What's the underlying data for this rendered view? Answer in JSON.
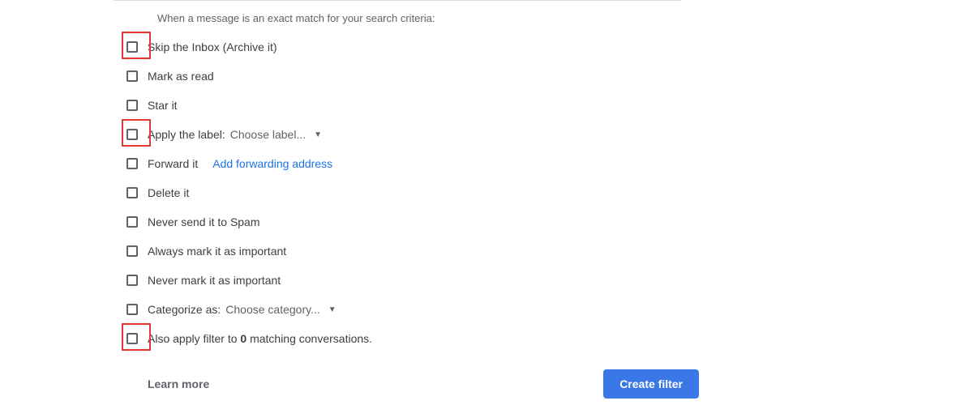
{
  "header": "When a message is an exact match for your search criteria:",
  "options": {
    "skip_inbox": "Skip the Inbox (Archive it)",
    "mark_read": "Mark as read",
    "star": "Star it",
    "apply_label": "Apply the label:",
    "label_dropdown": "Choose label...",
    "forward": "Forward it",
    "forward_link": "Add forwarding address",
    "delete": "Delete it",
    "never_spam": "Never send it to Spam",
    "always_important": "Always mark it as important",
    "never_important": "Never mark it as important",
    "categorize": "Categorize as:",
    "category_dropdown": "Choose category...",
    "also_apply_prefix": "Also apply filter to ",
    "also_apply_count": "0",
    "also_apply_suffix": " matching conversations."
  },
  "footer": {
    "learn_more": "Learn more",
    "create_filter": "Create filter"
  }
}
